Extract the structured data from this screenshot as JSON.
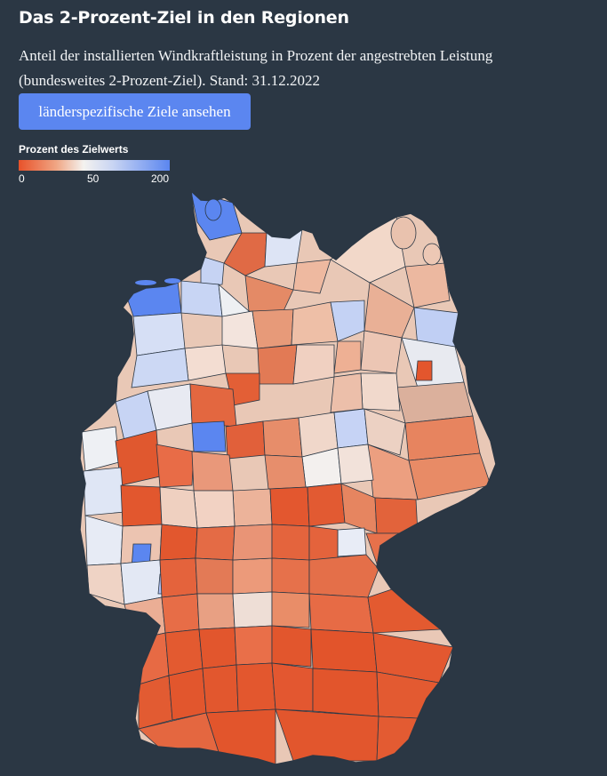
{
  "header": {
    "title": "Das 2-Prozent-Ziel in den Regionen",
    "subtitle": "Anteil der installierten Windkraftleistung in Prozent der angestrebten Leistung (bundesweites 2-Prozent-Ziel). Stand: 31.12.2022",
    "button_label": "länderspezifische Ziele ansehen"
  },
  "legend": {
    "title": "Prozent des Zielwerts",
    "ticks": [
      "0",
      "50",
      "200"
    ],
    "colors": {
      "low": "#e8522a",
      "mid": "#f4f2ef",
      "high": "#5b86f0"
    }
  },
  "colors": {
    "background": "#2b3744",
    "button": "#5b86f0",
    "district_border": "#2b3744"
  }
}
